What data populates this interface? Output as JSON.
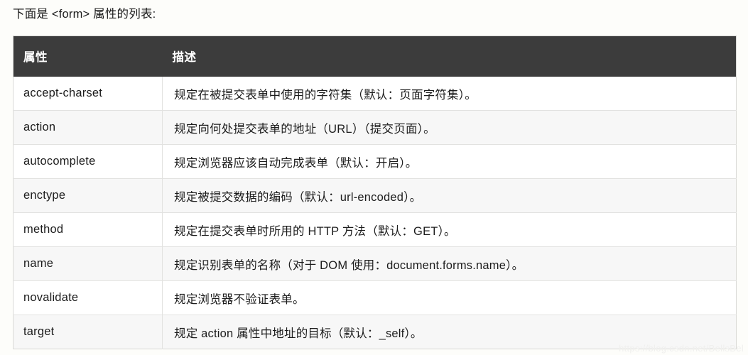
{
  "page": {
    "background_color": "#fdfdfa",
    "intro_text": "下面是 <form> 属性的列表:",
    "watermark": "https://blog.csdn.net/BellsBel"
  },
  "table": {
    "header_background": "#3c3c3c",
    "header_text_color": "#ffffff",
    "row_alt_background": "#f7f7f7",
    "columns": [
      {
        "key": "attribute",
        "label": "属性"
      },
      {
        "key": "description",
        "label": "描述"
      }
    ],
    "rows": [
      {
        "attribute": "accept-charset",
        "description": "规定在被提交表单中使用的字符集（默认：页面字符集）。"
      },
      {
        "attribute": "action",
        "description": "规定向何处提交表单的地址（URL）（提交页面）。"
      },
      {
        "attribute": "autocomplete",
        "description": "规定浏览器应该自动完成表单（默认：开启）。"
      },
      {
        "attribute": "enctype",
        "description": "规定被提交数据的编码（默认：url-encoded）。"
      },
      {
        "attribute": "method",
        "description": "规定在提交表单时所用的 HTTP 方法（默认：GET）。"
      },
      {
        "attribute": "name",
        "description": "规定识别表单的名称（对于 DOM 使用：document.forms.name）。"
      },
      {
        "attribute": "novalidate",
        "description": "规定浏览器不验证表单。"
      },
      {
        "attribute": "target",
        "description": "规定 action 属性中地址的目标（默认：_self）。"
      }
    ]
  }
}
